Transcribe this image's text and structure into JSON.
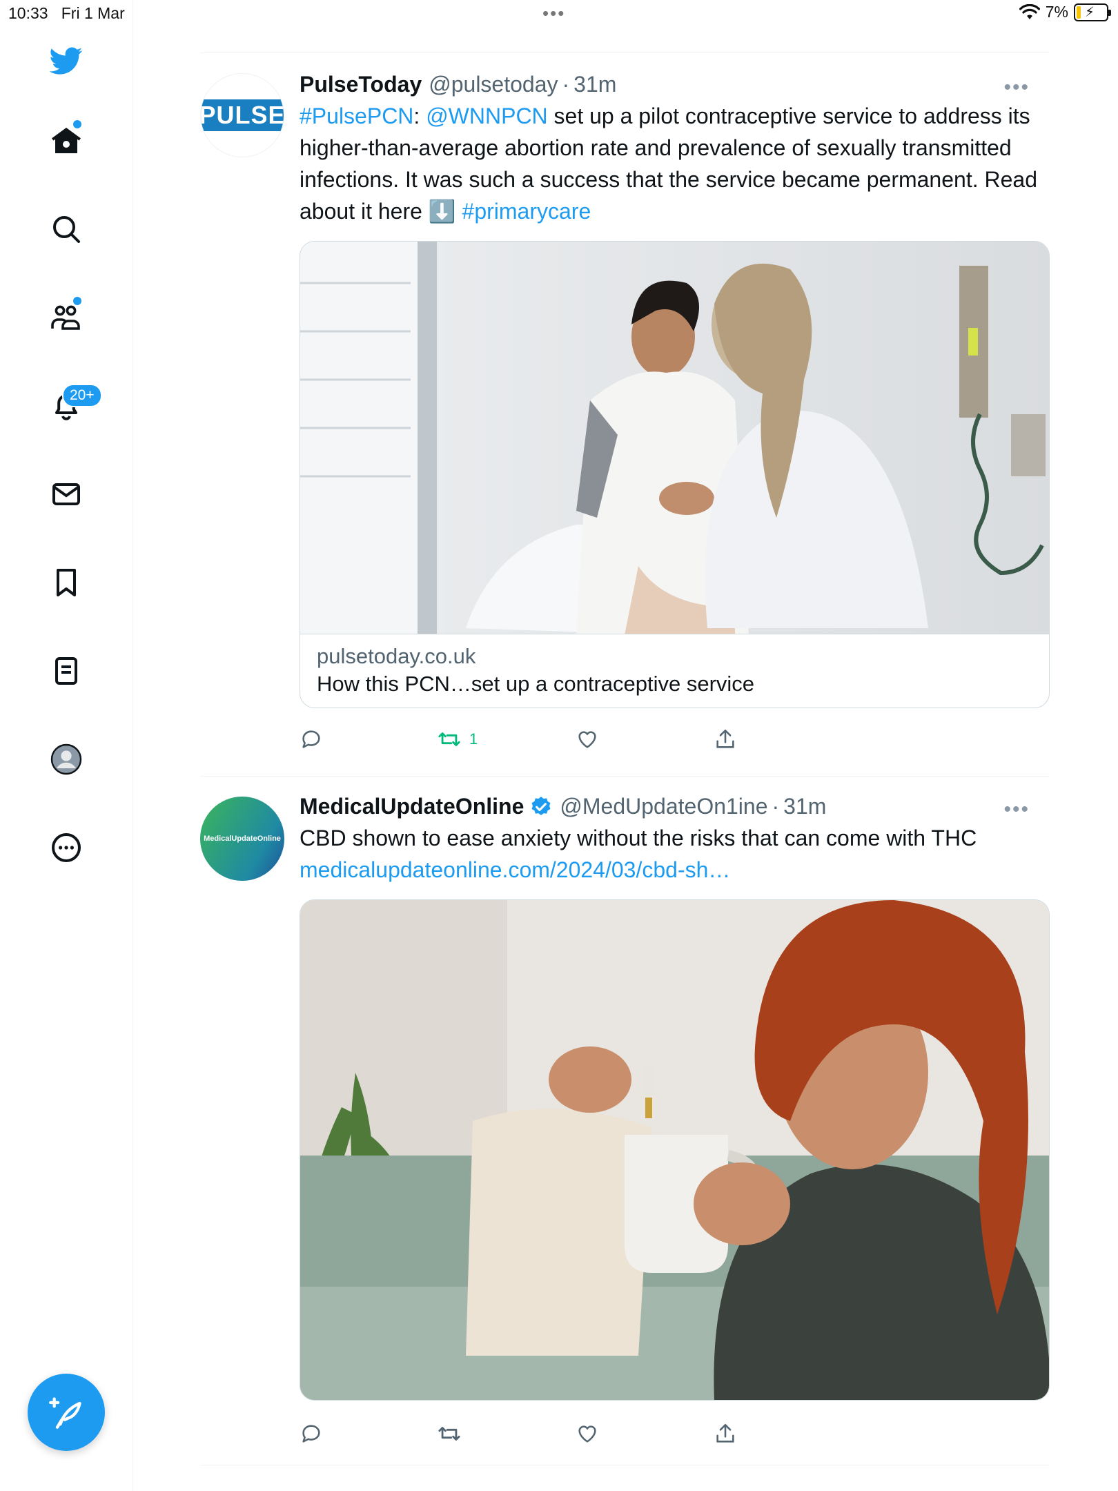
{
  "status": {
    "time": "10:33",
    "date": "Fri 1 Mar",
    "battery": "7%"
  },
  "sidebar": {
    "notifications_badge": "20+",
    "items": [
      {
        "icon": "twitter-bird-icon"
      },
      {
        "icon": "home-icon"
      },
      {
        "icon": "search-icon"
      },
      {
        "icon": "communities-icon"
      },
      {
        "icon": "bell-icon"
      },
      {
        "icon": "mail-icon"
      },
      {
        "icon": "bookmark-icon"
      },
      {
        "icon": "lists-icon"
      },
      {
        "icon": "profile-icon"
      },
      {
        "icon": "more-circle-icon"
      }
    ],
    "compose_icon": "compose-feather-icon"
  },
  "tweets": [
    {
      "name": "PulseToday",
      "handle": "@pulsetoday",
      "sep": "·",
      "time": "31m",
      "avatar_text": "PULSE",
      "text_parts": {
        "tag1": "#PulsePCN",
        "colon": ": ",
        "mention": "@WNNPCN",
        "body": " set up a pilot contraceptive service to address its higher-than-average abortion rate and prevalence of sexually transmitted infections. It was such a success that the service became permanent. Read about it here ",
        "arrow": "⬇️",
        "tag2": " #primarycare"
      },
      "card": {
        "domain": "pulsetoday.co.uk",
        "title": "How this PCN…set up a contraceptive service"
      },
      "retweets": "1"
    },
    {
      "name": "MedicalUpdateOnline",
      "handle": "@MedUpdateOn1ine",
      "sep": "·",
      "time": "31m",
      "avatar_text": "MedicalUpdateOnline",
      "text": "CBD shown to ease anxiety without the risks that can come with THC",
      "link": "medicalupdateonline.com/2024/03/cbd-sh…"
    }
  ],
  "colors": {
    "accent": "#1d9bf0",
    "retweet": "#00ba7c",
    "muted": "#536471"
  }
}
